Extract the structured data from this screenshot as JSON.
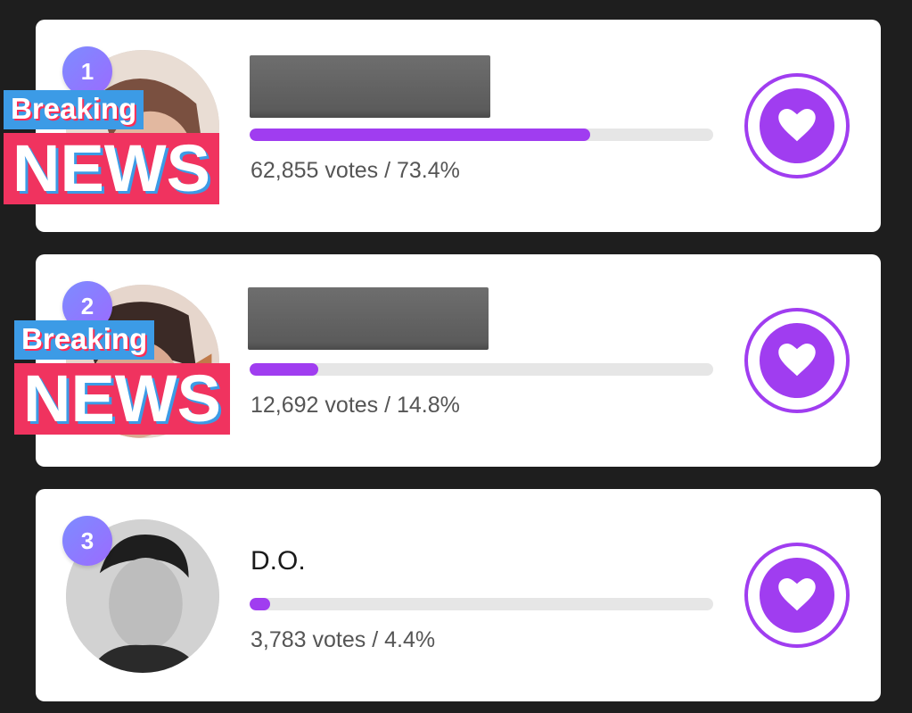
{
  "colors": {
    "accent": "#a03df0",
    "track": "#e6e6e6",
    "news_blue": "#3c9be6",
    "news_red": "#f0335f"
  },
  "overlay": {
    "breaking": "Breaking",
    "news": "NEWS"
  },
  "entries": [
    {
      "rank": "1",
      "name": "",
      "name_redacted": true,
      "votes_text": "62,855 votes / 73.4%",
      "percent": 73.4,
      "icon": "heart-icon"
    },
    {
      "rank": "2",
      "name": "",
      "name_redacted": true,
      "votes_text": "12,692 votes / 14.8%",
      "percent": 14.8,
      "icon": "heart-icon"
    },
    {
      "rank": "3",
      "name": "D.O.",
      "name_redacted": false,
      "votes_text": "3,783 votes / 4.4%",
      "percent": 4.4,
      "icon": "heart-icon"
    }
  ]
}
